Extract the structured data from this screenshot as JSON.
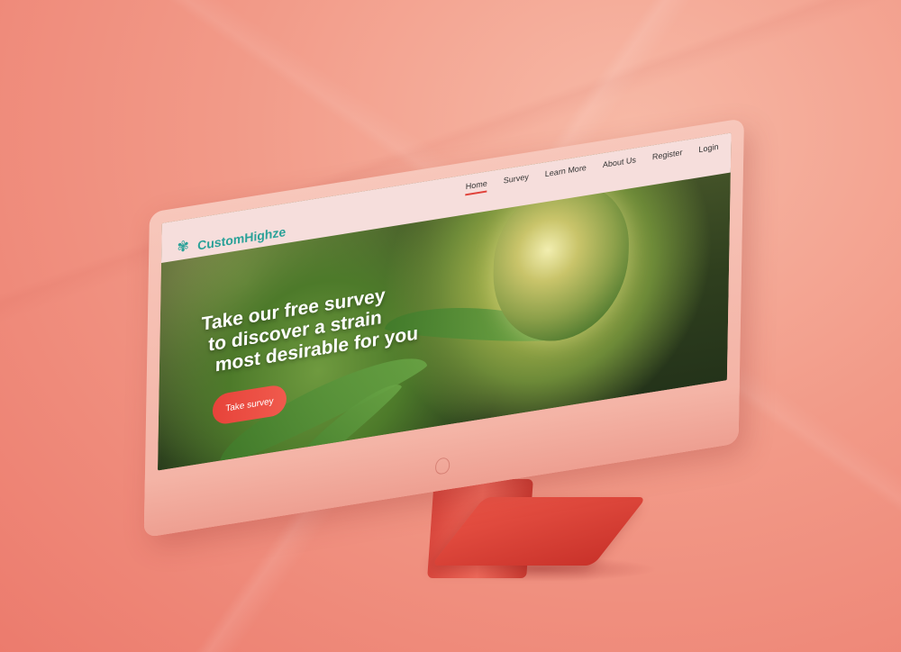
{
  "brand": {
    "logo_text": "CustomHighze",
    "logo_icon": "cannabis-leaf-icon",
    "color": "#2aa198"
  },
  "nav": {
    "items": [
      {
        "label": "Home",
        "active": true
      },
      {
        "label": "Survey",
        "active": false
      },
      {
        "label": "Learn More",
        "active": false
      },
      {
        "label": "About Us",
        "active": false
      },
      {
        "label": "Register",
        "active": false
      },
      {
        "label": "Login",
        "active": false
      }
    ],
    "active_underline_color": "#e0423a"
  },
  "hero": {
    "headline_line1": "Take our free survey",
    "headline_line2": "to discover a strain",
    "headline_line3": "most desirable for you",
    "cta_label": "Take survey",
    "cta_color": "#e7433a"
  },
  "colors": {
    "background": "#f29a88",
    "monitor": "#f7c7bb",
    "stand": "#e04a3f"
  }
}
